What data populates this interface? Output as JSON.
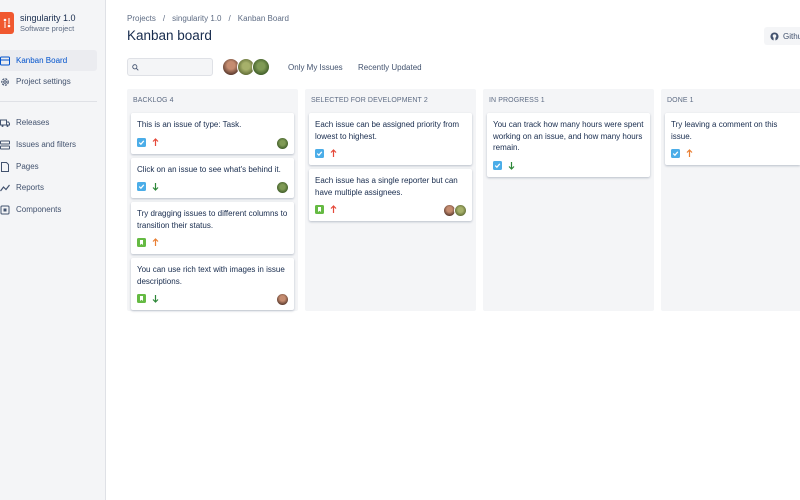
{
  "project": {
    "name": "singularity 1.0",
    "type": "Software project"
  },
  "sidebar": {
    "items": [
      {
        "label": "Kanban Board",
        "icon": "board-icon",
        "active": true
      },
      {
        "label": "Project settings",
        "icon": "gear-icon",
        "active": false
      },
      {
        "label": "Releases",
        "icon": "truck-icon",
        "active": false
      },
      {
        "label": "Issues and filters",
        "icon": "stack-icon",
        "active": false
      },
      {
        "label": "Pages",
        "icon": "page-icon",
        "active": false
      },
      {
        "label": "Reports",
        "icon": "trend-icon",
        "active": false
      },
      {
        "label": "Components",
        "icon": "component-icon",
        "active": false
      }
    ]
  },
  "breadcrumb": [
    "Projects",
    "singularity 1.0",
    "Kanban Board"
  ],
  "page_title": "Kanban board",
  "github_label": "Github",
  "filters": {
    "search_value": "",
    "only_my": "Only My Issues",
    "recent": "Recently Updated"
  },
  "colors": {
    "accent": "#0052cc",
    "task": "#4bade8",
    "story": "#65ba43",
    "high": "#e5493a",
    "medium": "#e97f33",
    "low": "#2d8738",
    "logo": "#f0582f"
  },
  "columns": [
    {
      "title": "BACKLOG 4",
      "cards": [
        {
          "title": "This is an issue of type: Task.",
          "type": "task",
          "priority": "up-red",
          "avatars": [
            "green"
          ]
        },
        {
          "title": "Click on an issue to see what's behind it.",
          "type": "task",
          "priority": "down-green",
          "avatars": [
            "green"
          ]
        },
        {
          "title": "Try dragging issues to different columns to transition their status.",
          "type": "story",
          "priority": "up-orange",
          "avatars": []
        },
        {
          "title": "You can use rich text with images in issue descriptions.",
          "type": "story",
          "priority": "down-green",
          "avatars": [
            "brown"
          ]
        }
      ]
    },
    {
      "title": "SELECTED FOR DEVELOPMENT 2",
      "cards": [
        {
          "title": "Each issue can be assigned priority from lowest to highest.",
          "type": "task",
          "priority": "up-red",
          "avatars": []
        },
        {
          "title": "Each issue has a single reporter but can have multiple assignees.",
          "type": "story",
          "priority": "up-red",
          "avatars": [
            "brown",
            "olive"
          ]
        }
      ]
    },
    {
      "title": "IN PROGRESS 1",
      "cards": [
        {
          "title": "You can track how many hours were spent working on an issue, and how many hours remain.",
          "type": "task",
          "priority": "down-green",
          "avatars": []
        }
      ]
    },
    {
      "title": "DONE 1",
      "cards": [
        {
          "title": "Try leaving a comment on this issue.",
          "type": "task",
          "priority": "up-orange",
          "avatars": []
        }
      ]
    }
  ]
}
